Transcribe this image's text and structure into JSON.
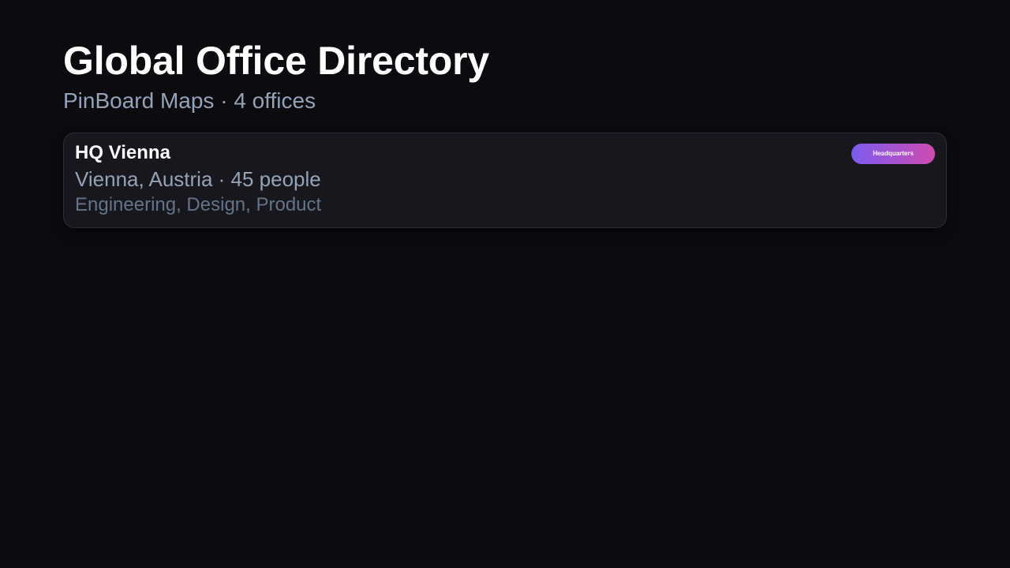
{
  "header": {
    "title": "Global Office Directory",
    "subtitle": "PinBoard Maps · 4 offices"
  },
  "offices": [
    {
      "name": "HQ Vienna",
      "meta": "Vienna, Austria · 45 people",
      "departments": "Engineering, Design, Product",
      "badge": "Headquarters"
    }
  ],
  "colors": {
    "background": "#0b0b10",
    "card": "#18171d",
    "badge_gradient_start": "#7b5cf0",
    "badge_gradient_end": "#d04ab0"
  }
}
